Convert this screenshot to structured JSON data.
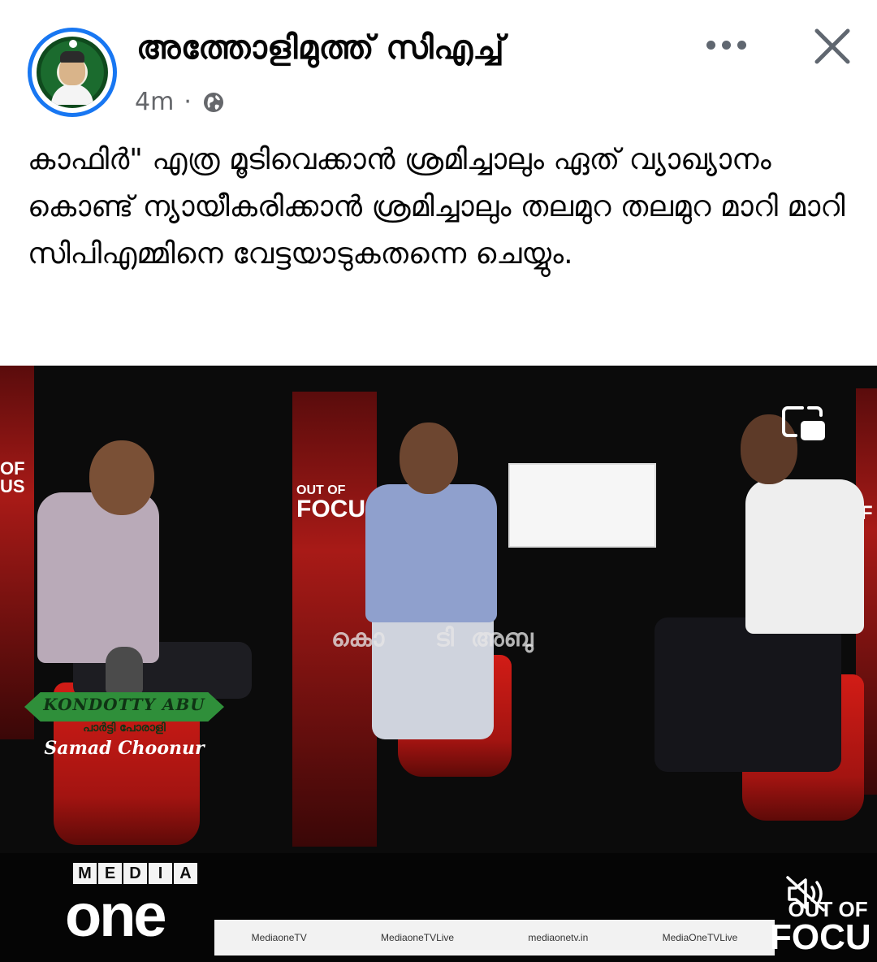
{
  "post": {
    "page_name": "അത്തോളിമുത്ത് സിഎച്ച്",
    "time": "4m",
    "separator": "·",
    "audience_icon": "globe-icon",
    "caption": "കാഫിർ\" എത്ര മൂടിവെക്കാൻ ശ്രമിച്ചാലും ഏത് വ്യാഖ്യാനം കൊണ്ട് ന്യായീകരിക്കാൻ ശ്രമിച്ചാലും തലമുറ തലമുറ മാറി മാറി സിപിഎമ്മിനെ വേട്ടയാടുകതന്നെ ചെയ്യും."
  },
  "header": {
    "more_icon": "more-options-icon",
    "close_icon": "close-icon",
    "accent": "#1877f2"
  },
  "video": {
    "panel_logo_left": "OF\nUS",
    "panel_logo_mid_top": "OUT OF",
    "panel_logo_mid_bottom": "FOCUS",
    "panel_logo_right": "F",
    "overlay_text": "കൊ      ടി  അബു",
    "watermark_title": "KONDOTTY ABU",
    "watermark_sub": "പാർട്ടി പോരാളി",
    "watermark_name": "Samad Choonur",
    "channel_letters": [
      "M",
      "E",
      "D",
      "I",
      "A"
    ],
    "channel_one": "one",
    "ticker": [
      "MediaoneTV",
      "MediaoneTVLive",
      "mediaonetv.in",
      "MediaOneTVLive"
    ],
    "brand_out": "OUT OF",
    "brand_focus": "FOCU",
    "pip_icon": "picture-in-picture-icon",
    "mute_icon": "speaker-muted-icon"
  }
}
